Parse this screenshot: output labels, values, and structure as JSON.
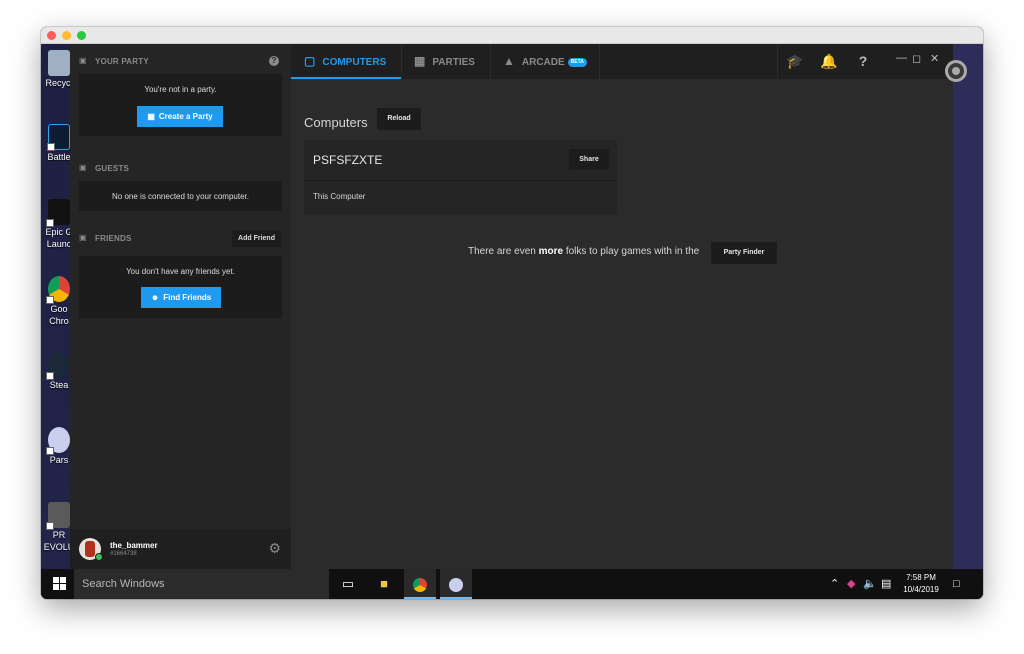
{
  "desktop": {
    "icons": [
      {
        "label": "Recycl",
        "name": "recycle-bin"
      },
      {
        "label": "Battle",
        "name": "battle-net"
      },
      {
        "label": "Epic G",
        "label2": "Launc",
        "name": "epic-games"
      },
      {
        "label": "Goo",
        "label2": "Chro",
        "name": "google-chrome"
      },
      {
        "label": "Stea",
        "name": "steam"
      },
      {
        "label": "Pars",
        "name": "parsec"
      },
      {
        "label": "PR",
        "label2": "EVOLU",
        "name": "pro-evolution"
      }
    ]
  },
  "sidebar": {
    "party": {
      "title": "YOUR PARTY",
      "message": "You're not in a party.",
      "create_button": "Create a Party"
    },
    "guests": {
      "title": "GUESTS",
      "message": "No one is connected to your computer."
    },
    "friends": {
      "title": "FRIENDS",
      "add_button": "Add Friend",
      "message": "You don't have any friends yet.",
      "find_button": "Find Friends"
    },
    "user": {
      "name": "the_bammer",
      "id": "#1664738"
    }
  },
  "tabs": [
    {
      "label": "COMPUTERS",
      "icon": "monitor-icon",
      "active": true
    },
    {
      "label": "PARTIES",
      "icon": "sofa-icon",
      "active": false
    },
    {
      "label": "ARCADE",
      "icon": "joystick-icon",
      "badge": "BETA",
      "active": false
    }
  ],
  "main": {
    "title": "Computers",
    "reload_button": "Reload",
    "computer": {
      "name": "PSFSFZXTE",
      "share_button": "Share",
      "subtitle": "This Computer"
    },
    "finder_prefix": "There are even ",
    "finder_bold": "more",
    "finder_suffix": " folks to play games with in the",
    "finder_button": "Party Finder"
  },
  "taskbar": {
    "search_placeholder": "Search Windows",
    "time": "7:58 PM",
    "date": "10/4/2019"
  },
  "colors": {
    "accent": "#1e9bf0",
    "sidebar": "#252526",
    "app_bg": "#2b2b2c",
    "online": "#3cc25b"
  }
}
